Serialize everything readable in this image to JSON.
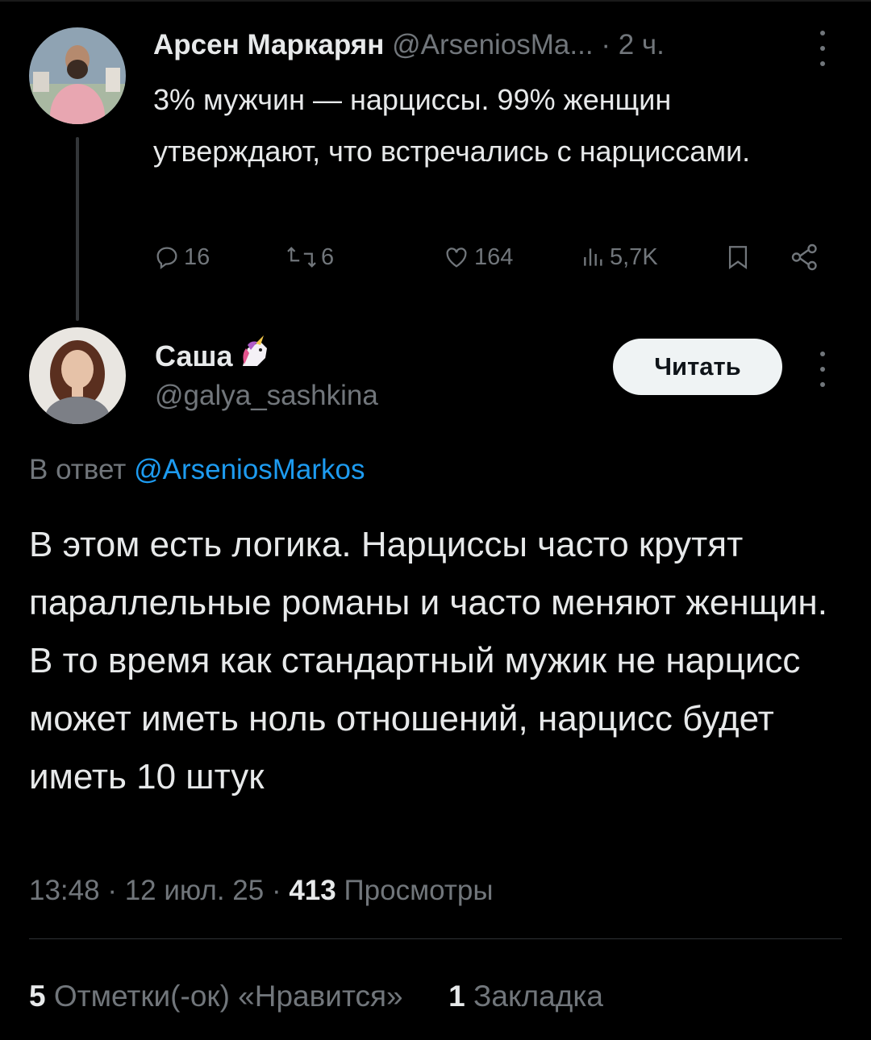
{
  "parent_tweet": {
    "author_name": "Арсен Маркарян",
    "author_handle": "@ArseniosMa...",
    "separator": "·",
    "time": "2 ч.",
    "text": "3% мужчин — нарциссы. 99% женщин утверждают, что встречались с нарциссами.",
    "actions": {
      "replies": "16",
      "retweets": "6",
      "likes": "164",
      "views": "5,7K"
    }
  },
  "reply_tweet": {
    "author_name": "Саша",
    "author_handle": "@galya_sashkina",
    "follow_label": "Читать",
    "reply_prefix": "В ответ",
    "reply_to": "@ArseniosMarkos",
    "text": "В этом есть логика. Нарциссы часто крутят параллельные романы и часто меняют женщин. В то время как стандартный мужик не нарцисс может иметь ноль отношений, нарцисс будет иметь 10 штук",
    "time": "13:48",
    "date": "12 июл. 25",
    "views_count": "413",
    "views_label": "Просмотры",
    "likes_count": "5",
    "likes_label": "Отметки(-ок) «Нравится»",
    "bookmarks_count": "1",
    "bookmarks_label": "Закладка"
  },
  "colors": {
    "background": "#000000",
    "text_primary": "#e7e9ea",
    "text_secondary": "#71767b",
    "link": "#1d9bf0",
    "button_bg": "#eff3f4"
  },
  "icons": [
    "reply-icon",
    "retweet-icon",
    "like-icon",
    "views-icon",
    "bookmark-icon",
    "share-icon",
    "more-icon",
    "unicorn-icon"
  ]
}
